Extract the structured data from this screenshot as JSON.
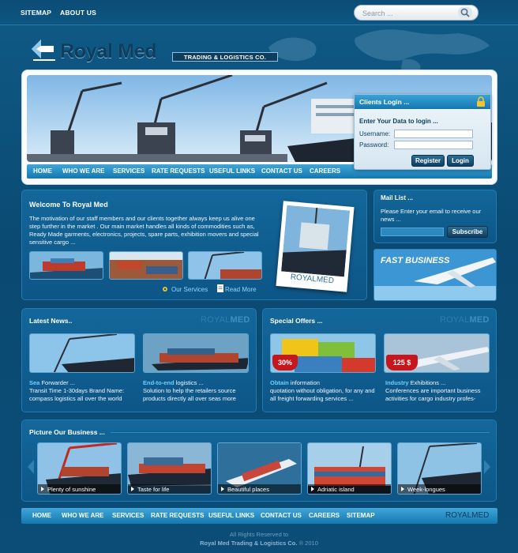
{
  "top": {
    "links": [
      "SITEMAP",
      "ABOUT US"
    ],
    "search_placeholder": "Search ..."
  },
  "brand": {
    "name": "Royal Med",
    "tagline": "TRADING & LOGISTICS CO."
  },
  "nav": [
    "HOME",
    "WHO WE ARE",
    "SERVICES",
    "RATE REQUESTS",
    "USEFUL LINKS",
    "CONTACT US",
    "CAREERS"
  ],
  "login": {
    "title": "Clients Login ...",
    "prompt": "Enter Your Data to login ...",
    "username_label": "Username:",
    "password_label": "Password:",
    "register": "Register",
    "login": "Login"
  },
  "welcome": {
    "title": "Welcome To Royal Med",
    "text": "The motivation of our staff members and our clients together always keep  us alive one step further in the market . Our main market handles all kinds of commodities such as, Ready Made garments, electronics, projects, spare parts, exhibition movers and special sensitive cargo ...",
    "our_services": "Our Services",
    "read_more": "Read More",
    "photo_caption": "ROYALMED"
  },
  "mail": {
    "title": "Mail List ...",
    "text": "Please Enter your email to receive our news ...",
    "subscribe": "Subscribe",
    "banner": "FAST BUSINESS"
  },
  "watermark": {
    "a": "ROYAL",
    "b": "MED"
  },
  "latest_news": {
    "title": "Latest News..",
    "items": [
      {
        "hl": "Sea",
        "rest": " Forwarder ...",
        "body": "Transit Time 1-30days Brand Name: compass logistics all over the world"
      },
      {
        "hl": "End-to-end",
        "rest": " logistics ...",
        "body": "Solution to help the retailers source products directly all over seas more"
      }
    ]
  },
  "special_offers": {
    "title": "Special Offers ...",
    "items": [
      {
        "badge": "30%",
        "hl": "Obtain",
        "rest": " information",
        "body": "quotation without obligation, for any and all freight forwarding services ..."
      },
      {
        "badge": "125 $",
        "hl": "Industry",
        "rest": " Exhibitions ...",
        "body": "Conferences are important business activities for cargo industry profes-"
      }
    ]
  },
  "gallery": {
    "title": "Picture Our Business ...",
    "items": [
      "Plenty of sunshine",
      "Taste for life",
      "Beautiful places",
      "Adriatic island",
      "Week-longues"
    ]
  },
  "footer": {
    "nav": [
      "HOME",
      "WHO WE ARE",
      "SERVICES",
      "RATE REQUESTS",
      "USEFUL LINKS",
      "CONTACT US",
      "CAREERS",
      "SITEMAP"
    ],
    "line1": "All Rights Reserved to",
    "line2": "Royal Med Trading & Logistics Co.",
    "line2_suffix": " ® 2010"
  },
  "colors": {
    "accent": "#1478b1",
    "highlight": "#6fd0ff",
    "badge": "#c8161d"
  }
}
